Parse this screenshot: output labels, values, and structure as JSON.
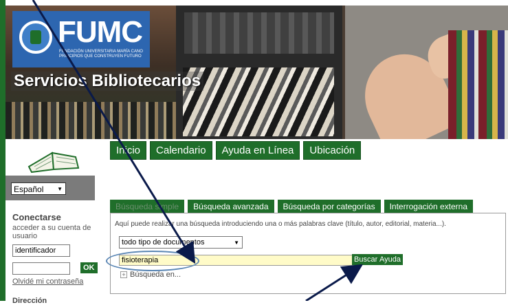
{
  "banner": {
    "logo_text": "FUMC",
    "logo_subtitle": "FUNDACIÓN UNIVERSITARIA MARÍA CANO PRINCIPIOS QUE CONSTRUYEN FUTURO",
    "title": "Servicios Bibliotecarios"
  },
  "nav": {
    "items": [
      "Inicio",
      "Calendario",
      "Ayuda en Línea",
      "Ubicación"
    ]
  },
  "sidebar": {
    "language": "Español",
    "login_title": "Conectarse",
    "login_desc": "acceder a su cuenta de usuario",
    "user_placeholder": "identificador",
    "ok_label": "OK",
    "forgot_label": "Olvidé mi contraseña",
    "direccion_label": "Dirección"
  },
  "search": {
    "tabs": [
      "Búsqueda simple",
      "Búsqueda avanzada",
      "Búsqueda por categorías",
      "Interrogación externa"
    ],
    "description": "Aquí puede realizar una búsqueda introduciendo una o más palabras clave (título, autor, editorial, materia...).",
    "doc_type": "todo tipo de documentos",
    "query": "fisioterapia",
    "search_button": "Buscar",
    "help_button": "Ayuda",
    "search_in": "Búsqueda en..."
  },
  "colors": {
    "brand_green": "#1f6e2a",
    "annotation_blue": "#5a86b4",
    "input_yellow": "#fffbc8"
  }
}
